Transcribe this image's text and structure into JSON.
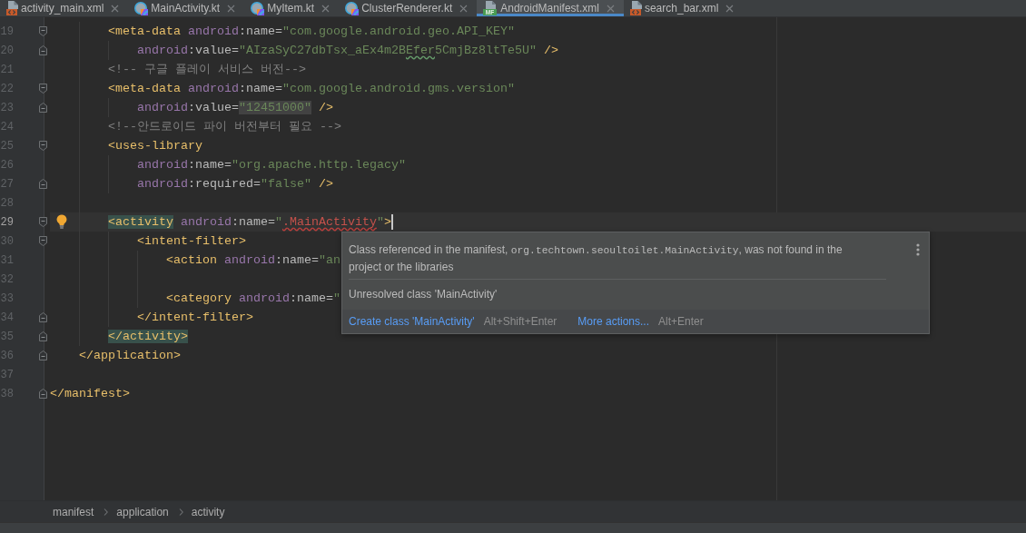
{
  "tabs": [
    {
      "label": "activity_main.xml",
      "kind": "xml",
      "selected": false
    },
    {
      "label": "MainActivity.kt",
      "kind": "kotlin",
      "selected": false
    },
    {
      "label": "MyItem.kt",
      "kind": "kotlin",
      "selected": false
    },
    {
      "label": "ClusterRenderer.kt",
      "kind": "kotlin",
      "selected": false
    },
    {
      "label": "AndroidManifest.xml",
      "kind": "manifest",
      "icon_label": "MF",
      "selected": true
    },
    {
      "label": "search_bar.xml",
      "kind": "xml",
      "selected": false
    }
  ],
  "editor": {
    "lines": [
      {
        "number": "19",
        "kind": "open",
        "bulb": false,
        "current": false,
        "tokens": [
          {
            "kind": "tag",
            "text": "        <meta-data"
          },
          {
            "kind": "ns",
            "text": " android"
          },
          {
            "kind": "attr",
            "text": ":name="
          },
          {
            "kind": "str",
            "text": "\"com.google.android.geo.API_KEY\""
          }
        ]
      },
      {
        "number": "20",
        "kind": "close",
        "bulb": false,
        "current": false,
        "tokens": [
          {
            "kind": "ns",
            "text": "            android"
          },
          {
            "kind": "attr",
            "text": ":value="
          },
          {
            "kind": "str",
            "text": "\"AIzaSyC27dbTsx_aEx4m2B"
          },
          {
            "kind": "typo",
            "text": "Efer"
          },
          {
            "kind": "str",
            "text": "5CmjBz8ltTe5U\""
          },
          {
            "kind": "tag",
            "text": " />"
          }
        ]
      },
      {
        "number": "21",
        "kind": "plain",
        "bulb": false,
        "current": false,
        "tokens": [
          {
            "kind": "cmt",
            "text": "        <!-- 구글 플레이 서비스 버전-->"
          }
        ]
      },
      {
        "number": "22",
        "kind": "open",
        "bulb": false,
        "current": false,
        "tokens": [
          {
            "kind": "tag",
            "text": "        <meta-data"
          },
          {
            "kind": "ns",
            "text": " android"
          },
          {
            "kind": "attr",
            "text": ":name="
          },
          {
            "kind": "str",
            "text": "\"com.google.android.gms.version\""
          }
        ]
      },
      {
        "number": "23",
        "kind": "close",
        "bulb": false,
        "current": false,
        "tokens": [
          {
            "kind": "ns",
            "text": "            android"
          },
          {
            "kind": "attr",
            "text": ":value="
          },
          {
            "kind": "marked",
            "text": "\"12451000\""
          },
          {
            "kind": "tag",
            "text": " />"
          }
        ]
      },
      {
        "number": "24",
        "kind": "plain",
        "bulb": false,
        "current": false,
        "tokens": [
          {
            "kind": "cmt",
            "text": "        <!--안드로이드 파이 버전부터 필요 -->"
          }
        ]
      },
      {
        "number": "25",
        "kind": "open",
        "bulb": false,
        "current": false,
        "tokens": [
          {
            "kind": "tag",
            "text": "        <uses-library"
          }
        ]
      },
      {
        "number": "26",
        "kind": "plain",
        "bulb": false,
        "current": false,
        "tokens": [
          {
            "kind": "ns",
            "text": "            android"
          },
          {
            "kind": "attr",
            "text": ":name="
          },
          {
            "kind": "str",
            "text": "\"org.apache.http.legacy\""
          }
        ]
      },
      {
        "number": "27",
        "kind": "close",
        "bulb": false,
        "current": false,
        "tokens": [
          {
            "kind": "ns",
            "text": "            android"
          },
          {
            "kind": "attr",
            "text": ":required="
          },
          {
            "kind": "str",
            "text": "\"false\""
          },
          {
            "kind": "tag",
            "text": " />"
          }
        ]
      },
      {
        "number": "28",
        "kind": "plain",
        "bulb": false,
        "current": false
      },
      {
        "number": "29",
        "kind": "open",
        "bulb": true,
        "current": true,
        "tokens": [
          {
            "kind": "matched",
            "text": "        <activity"
          },
          {
            "kind": "ns",
            "text": " android"
          },
          {
            "kind": "attr",
            "text": ":name="
          },
          {
            "kind": "str",
            "text": "\""
          },
          {
            "kind": "unresolved",
            "text": ".MainActivity"
          },
          {
            "kind": "str",
            "text": "\""
          },
          {
            "kind": "tag",
            "text": ">"
          }
        ]
      },
      {
        "number": "30",
        "kind": "open",
        "bulb": false,
        "current": false,
        "tokens": [
          {
            "kind": "tag",
            "text": "            <intent-filter>"
          }
        ]
      },
      {
        "number": "31",
        "kind": "plain",
        "bulb": false,
        "current": false,
        "tokens": [
          {
            "kind": "tag",
            "text": "                <action"
          },
          {
            "kind": "ns",
            "text": " android"
          },
          {
            "kind": "attr",
            "text": ":name="
          },
          {
            "kind": "str",
            "text": "\"an"
          }
        ]
      },
      {
        "number": "32",
        "kind": "plain",
        "bulb": false,
        "current": false
      },
      {
        "number": "33",
        "kind": "plain",
        "bulb": false,
        "current": false,
        "tokens": [
          {
            "kind": "tag",
            "text": "                <category"
          },
          {
            "kind": "ns",
            "text": " android"
          },
          {
            "kind": "attr",
            "text": ":name="
          },
          {
            "kind": "str",
            "text": "\""
          }
        ]
      },
      {
        "number": "34",
        "kind": "close",
        "bulb": false,
        "current": false,
        "tokens": [
          {
            "kind": "tag",
            "text": "            </intent-filter>"
          }
        ]
      },
      {
        "number": "35",
        "kind": "close",
        "bulb": false,
        "current": false,
        "tokens": [
          {
            "kind": "matched",
            "text": "        </activity>"
          }
        ]
      },
      {
        "number": "36",
        "kind": "close",
        "bulb": false,
        "current": false,
        "tokens": [
          {
            "kind": "tag",
            "text": "    </application>"
          }
        ]
      },
      {
        "number": "37",
        "kind": "plain",
        "bulb": false,
        "current": false
      },
      {
        "number": "38",
        "kind": "close",
        "bulb": false,
        "current": false,
        "tokens": [
          {
            "kind": "tag",
            "text": "</manifest>"
          }
        ]
      }
    ]
  },
  "popup": {
    "message": [
      {
        "kind": "text",
        "text": "Class referenced in the manifest, "
      },
      {
        "kind": "code",
        "text": "org.techtown.seoultoilet.MainActivity"
      },
      {
        "kind": "text",
        "text": ", was not found in the project or the libraries"
      }
    ],
    "problem": "Unresolved class 'MainActivity'",
    "actions": [
      {
        "label": "Create class 'MainActivity'",
        "shortcut": "Alt+Shift+Enter"
      },
      {
        "label": "More actions...",
        "shortcut": "Alt+Enter"
      }
    ]
  },
  "breadcrumbs": [
    "manifest",
    "application",
    "activity"
  ]
}
